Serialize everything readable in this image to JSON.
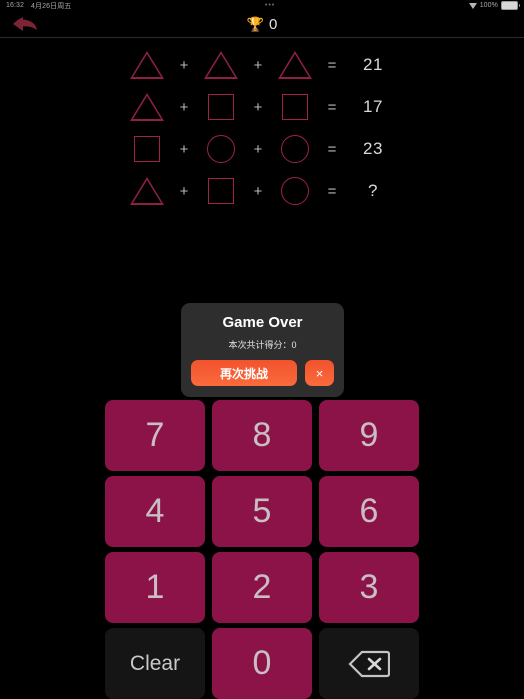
{
  "status_bar": {
    "time": "16:32",
    "date": "4月26日周五",
    "center": "•••",
    "wifi_icon": "wifi-icon",
    "battery_percent": "100%",
    "battery_icon": "battery-icon"
  },
  "header": {
    "back_icon": "back-arrow-icon",
    "trophy_icon": "🏆",
    "score": "0"
  },
  "equations": {
    "rows": [
      {
        "terms": [
          "triangle",
          "triangle",
          "triangle"
        ],
        "operators": [
          "+",
          "+"
        ],
        "equals": "=",
        "result": "21"
      },
      {
        "terms": [
          "triangle",
          "square",
          "square"
        ],
        "operators": [
          "+",
          "+"
        ],
        "equals": "=",
        "result": "17"
      },
      {
        "terms": [
          "square",
          "circle",
          "circle"
        ],
        "operators": [
          "+",
          "+"
        ],
        "equals": "=",
        "result": "23"
      },
      {
        "terms": [
          "triangle",
          "square",
          "circle"
        ],
        "operators": [
          "+",
          "+"
        ],
        "equals": "=",
        "result": "?"
      }
    ]
  },
  "dialog": {
    "title": "Game Over",
    "score_label": "本次共计得分：0",
    "retry_label": "再次挑战",
    "close_label": "×"
  },
  "keypad": {
    "keys": [
      {
        "label": "7",
        "type": "digit"
      },
      {
        "label": "8",
        "type": "digit"
      },
      {
        "label": "9",
        "type": "digit"
      },
      {
        "label": "4",
        "type": "digit"
      },
      {
        "label": "5",
        "type": "digit"
      },
      {
        "label": "6",
        "type": "digit"
      },
      {
        "label": "1",
        "type": "digit"
      },
      {
        "label": "2",
        "type": "digit"
      },
      {
        "label": "3",
        "type": "digit"
      },
      {
        "label": "Clear",
        "type": "clear"
      },
      {
        "label": "0",
        "type": "digit"
      },
      {
        "label": "",
        "type": "backspace",
        "icon": "backspace-icon"
      }
    ]
  },
  "colors": {
    "background": "#000000",
    "key_magenta": "#8c1348",
    "key_dark": "#151515",
    "shape_outline": "#9e2152",
    "accent_orange": "#f2532e",
    "dialog_bg": "#2e2e2e"
  }
}
